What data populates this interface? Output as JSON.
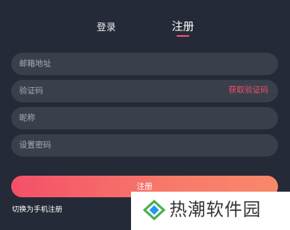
{
  "tabs": {
    "login": "登录",
    "register": "注册"
  },
  "fields": {
    "email_placeholder": "邮箱地址",
    "code_placeholder": "验证码",
    "get_code_label": "获取验证码",
    "nickname_placeholder": "昵称",
    "password_placeholder": "设置密码"
  },
  "submit_label": "注册",
  "switch_label": "切换为手机注册",
  "watermark": {
    "text": "热潮软件园"
  },
  "colors": {
    "background": "#252a38",
    "field": "#3a3f4c",
    "accent": "#f0506a",
    "button_gradient_start": "#f45068",
    "button_gradient_end": "#f8886a"
  }
}
